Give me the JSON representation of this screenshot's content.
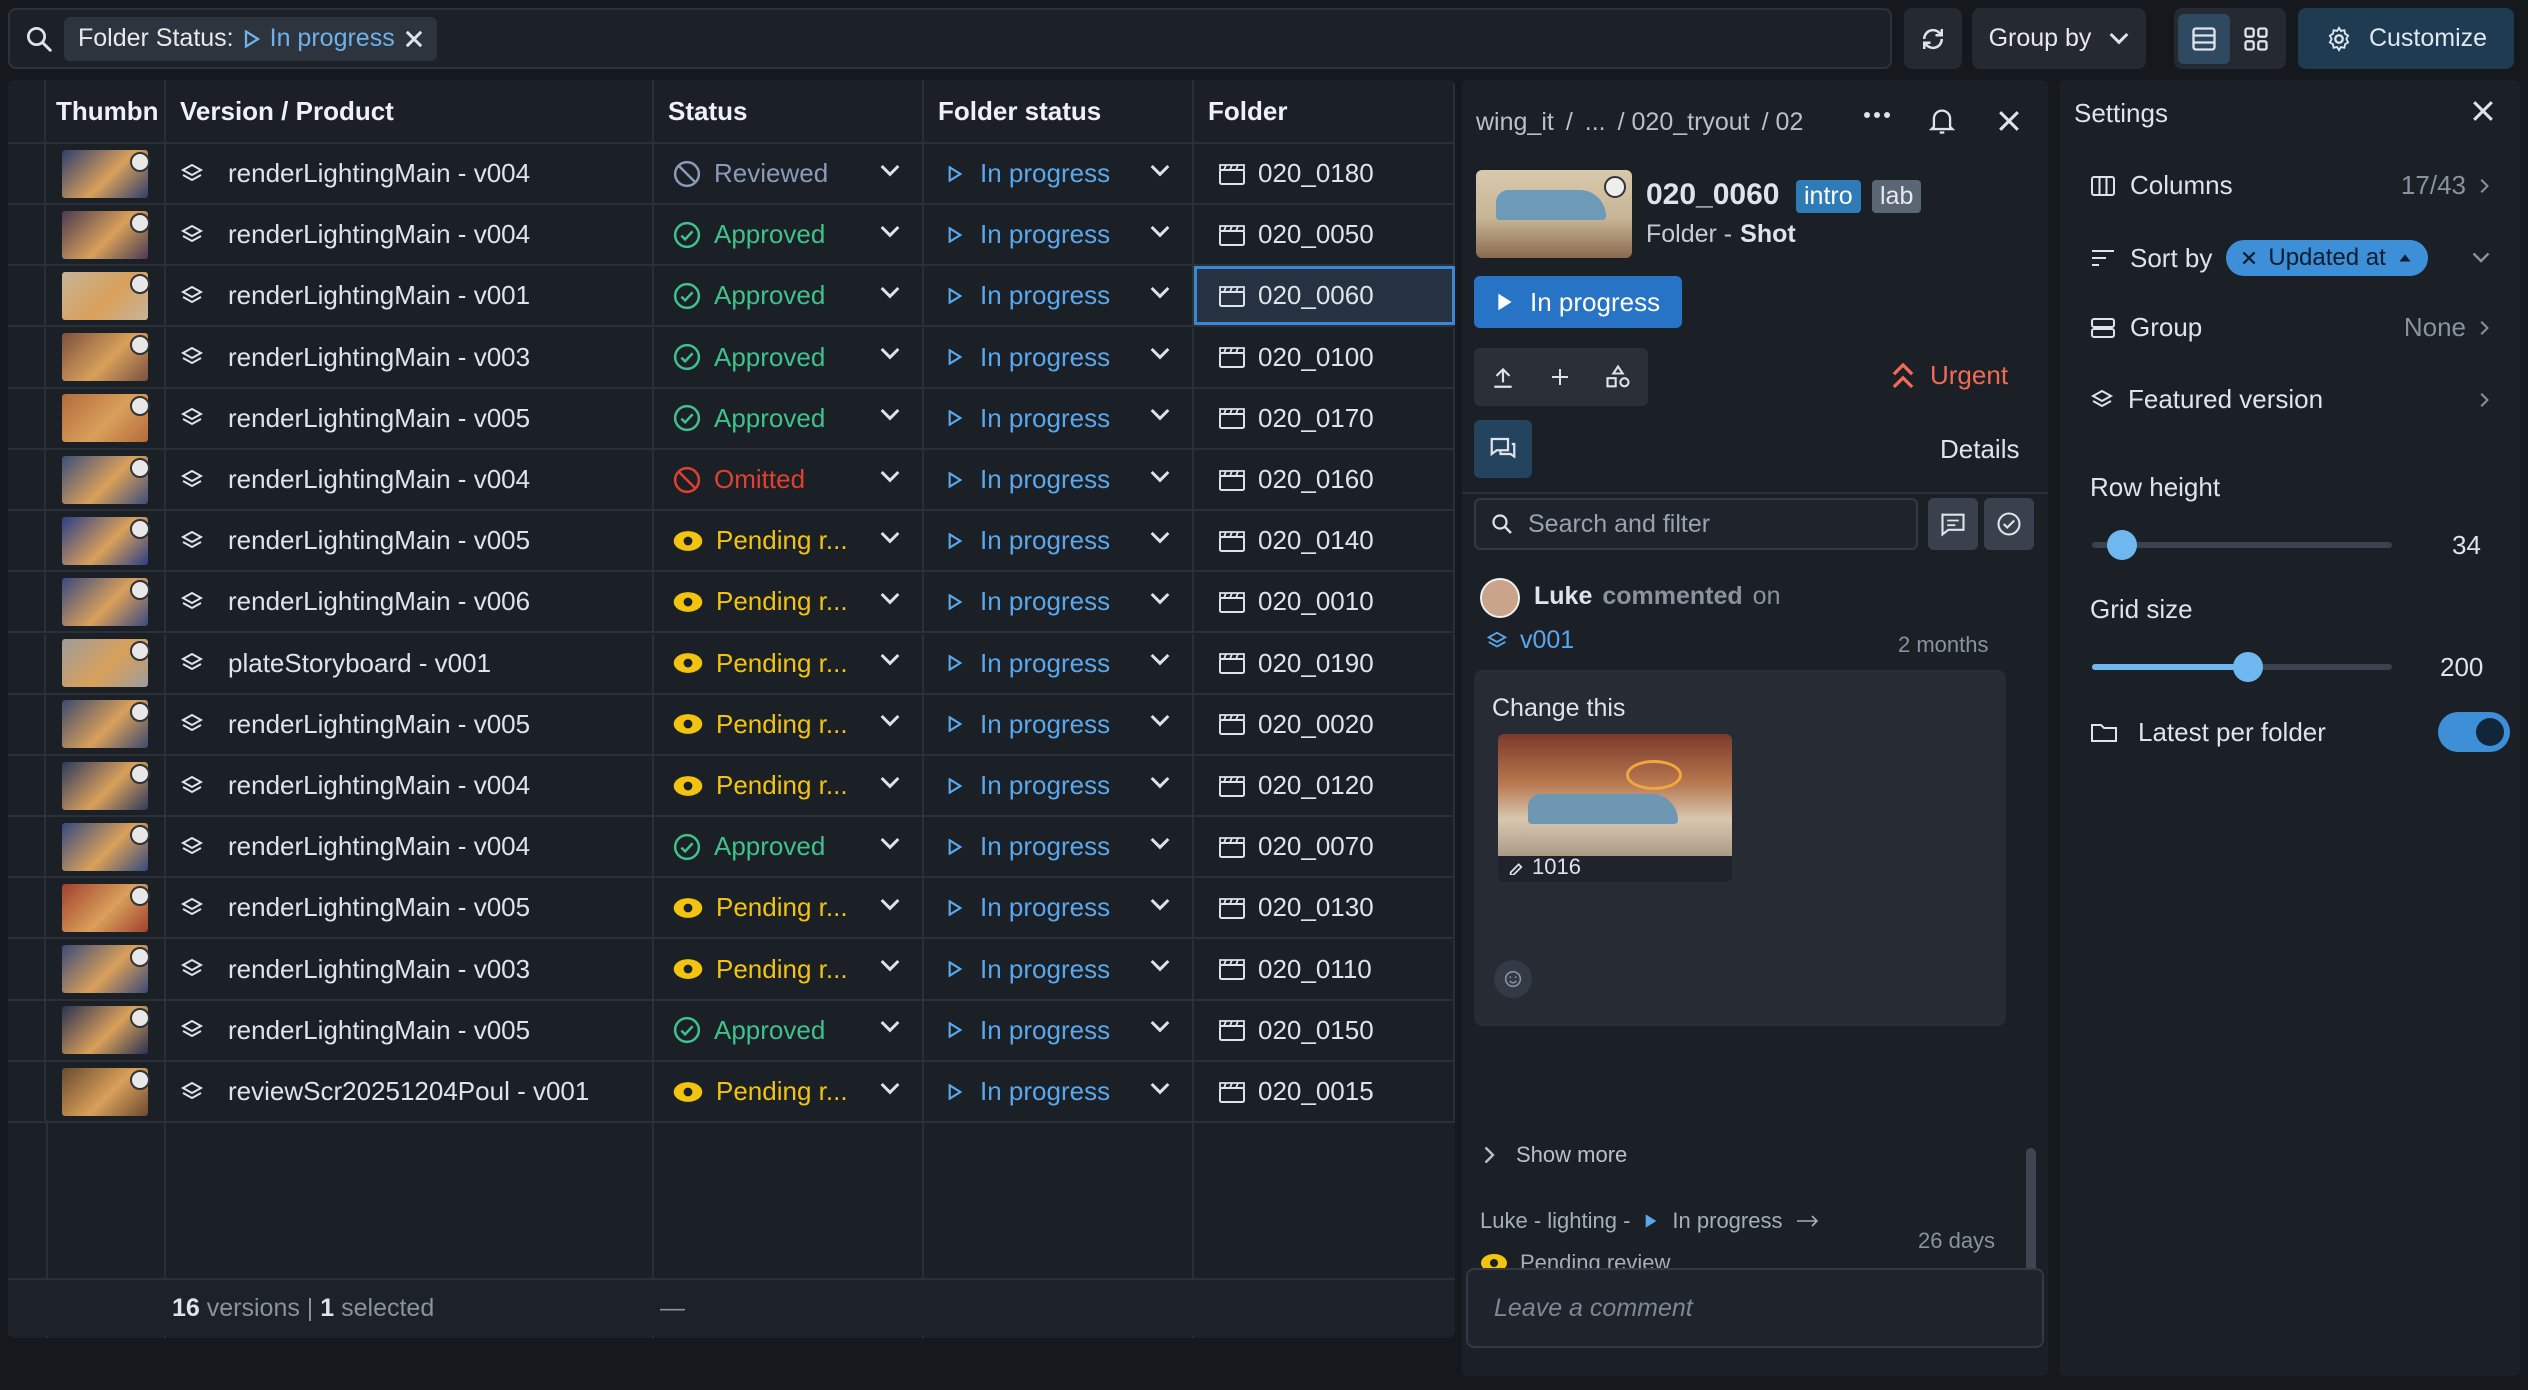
{
  "filter": {
    "label": "Folder Status:",
    "value": "In progress"
  },
  "toolbar": {
    "group_by": "Group by",
    "customize": "Customize"
  },
  "table": {
    "headers": [
      "Thumbn",
      "Version / Product",
      "Status",
      "Folder status",
      "Folder"
    ],
    "rows": [
      {
        "version": "renderLightingMain - v004",
        "status": "Reviewed",
        "status_kind": "reviewed",
        "folder_status": "In progress",
        "folder": "020_0180",
        "thumb": "#2e3f6e"
      },
      {
        "version": "renderLightingMain - v004",
        "status": "Approved",
        "status_kind": "approved",
        "folder_status": "In progress",
        "folder": "020_0050",
        "thumb": "#4a3b52"
      },
      {
        "version": "renderLightingMain - v001",
        "status": "Approved",
        "status_kind": "approved",
        "folder_status": "In progress",
        "folder": "020_0060",
        "thumb": "#c6b49a"
      },
      {
        "version": "renderLightingMain - v003",
        "status": "Approved",
        "status_kind": "approved",
        "folder_status": "In progress",
        "folder": "020_0100",
        "thumb": "#7a5040"
      },
      {
        "version": "renderLightingMain - v005",
        "status": "Approved",
        "status_kind": "approved",
        "folder_status": "In progress",
        "folder": "020_0170",
        "thumb": "#b36a3c"
      },
      {
        "version": "renderLightingMain - v004",
        "status": "Omitted",
        "status_kind": "omitted",
        "folder_status": "In progress",
        "folder": "020_0160",
        "thumb": "#3b4e7a"
      },
      {
        "version": "renderLightingMain - v005",
        "status": "Pending r...",
        "status_kind": "pending",
        "folder_status": "In progress",
        "folder": "020_0140",
        "thumb": "#2b3f86"
      },
      {
        "version": "renderLightingMain - v006",
        "status": "Pending r...",
        "status_kind": "pending",
        "folder_status": "In progress",
        "folder": "020_0010",
        "thumb": "#3a4a80"
      },
      {
        "version": "plateStoryboard - v001",
        "status": "Pending r...",
        "status_kind": "pending",
        "folder_status": "In progress",
        "folder": "020_0190",
        "thumb": "#9c9c9c"
      },
      {
        "version": "renderLightingMain - v005",
        "status": "Pending r...",
        "status_kind": "pending",
        "folder_status": "In progress",
        "folder": "020_0020",
        "thumb": "#3c4a6e"
      },
      {
        "version": "renderLightingMain - v004",
        "status": "Pending r...",
        "status_kind": "pending",
        "folder_status": "In progress",
        "folder": "020_0120",
        "thumb": "#2e3a5e"
      },
      {
        "version": "renderLightingMain - v004",
        "status": "Approved",
        "status_kind": "approved",
        "folder_status": "In progress",
        "folder": "020_0070",
        "thumb": "#334a7e"
      },
      {
        "version": "renderLightingMain - v005",
        "status": "Pending r...",
        "status_kind": "pending",
        "folder_status": "In progress",
        "folder": "020_0130",
        "thumb": "#a04030"
      },
      {
        "version": "renderLightingMain - v003",
        "status": "Pending r...",
        "status_kind": "pending",
        "folder_status": "In progress",
        "folder": "020_0110",
        "thumb": "#3a4a78"
      },
      {
        "version": "renderLightingMain - v005",
        "status": "Approved",
        "status_kind": "approved",
        "folder_status": "In progress",
        "folder": "020_0150",
        "thumb": "#2a3252"
      },
      {
        "version": "reviewScr20251204Poul - v001",
        "status": "Pending r...",
        "status_kind": "pending",
        "folder_status": "In progress",
        "folder": "020_0015",
        "thumb": "#6a4a30"
      }
    ],
    "footer": {
      "count": "16",
      "count_label": "versions |",
      "selected": "1",
      "selected_label": "selected",
      "dash": "—"
    }
  },
  "detail": {
    "breadcrumb": [
      "wing_it",
      "/",
      "...",
      "/ 020_tryout",
      "/ 02"
    ],
    "title": "020_0060",
    "tags": [
      "intro",
      "lab"
    ],
    "subtitle_prefix": "Folder -",
    "subtitle": "Shot",
    "status_button": "In progress",
    "priority": "Urgent",
    "tab_details": "Details",
    "search_placeholder": "Search and filter",
    "comment": {
      "author": "Luke",
      "action": "commented",
      "on": "on",
      "version": "v001",
      "time": "2 months",
      "body": "Change this",
      "frame": "1016"
    },
    "show_more": "Show more",
    "activity": {
      "text": "Luke - lighting -",
      "from": "In progress",
      "to": "Pending review",
      "time": "26 days"
    },
    "comment_placeholder": "Leave a comment"
  },
  "settings": {
    "title": "Settings",
    "columns_label": "Columns",
    "columns_value": "17/43",
    "sort_label": "Sort by",
    "sort_value": "Updated at",
    "group_label": "Group",
    "group_value": "None",
    "featured_label": "Featured version",
    "row_height_label": "Row height",
    "row_height_value": "34",
    "row_height_fraction": 0.1,
    "grid_size_label": "Grid size",
    "grid_size_value": "200",
    "grid_size_fraction": 0.52,
    "latest_label": "Latest per folder",
    "latest_on": true
  },
  "colors": {
    "accent": "#5aa7ec",
    "approved": "#3fc28a",
    "pending": "#f2c40f",
    "omitted": "#e0412f",
    "reviewed": "#8a9aba"
  }
}
